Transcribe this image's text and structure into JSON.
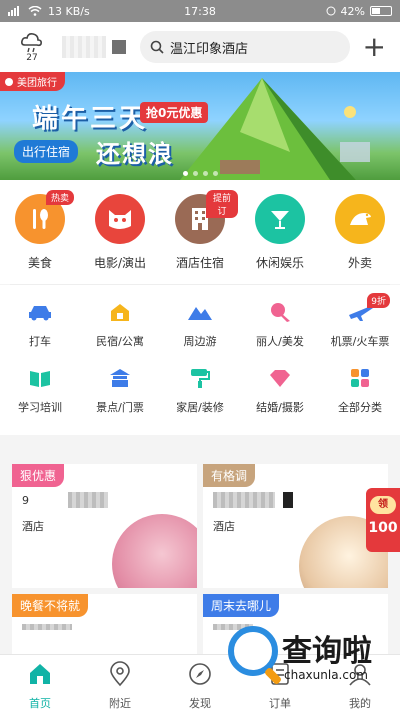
{
  "status_bar": {
    "left_text": "13 KB/s",
    "time": "17:38",
    "battery": "42%"
  },
  "header": {
    "weather_temp": "27",
    "search_text": "温江印象酒店",
    "plus_label": "+"
  },
  "banner": {
    "badge": "美团旅行",
    "title": "端午三天",
    "tag": "抢0元优惠",
    "sub": "出行住宿",
    "big": "还想浪"
  },
  "main_categories": [
    {
      "label": "美食",
      "badge": "热卖",
      "color": "#f7932e"
    },
    {
      "label": "电影/演出",
      "badge": "",
      "color": "#e8453c"
    },
    {
      "label": "酒店住宿",
      "badge": "提前订",
      "color": "#9a6a55"
    },
    {
      "label": "休闲娱乐",
      "badge": "",
      "color": "#1cc3a2"
    },
    {
      "label": "外卖",
      "badge": "",
      "color": "#f6b51c"
    }
  ],
  "sub_categories": [
    {
      "label": "打车",
      "badge": "",
      "icon": "car-icon",
      "color": "#3e7ce8"
    },
    {
      "label": "民宿/公寓",
      "badge": "",
      "icon": "house-icon",
      "color": "#f6b51c"
    },
    {
      "label": "周边游",
      "badge": "",
      "icon": "mountain-icon",
      "color": "#3e7ce8"
    },
    {
      "label": "丽人/美发",
      "badge": "",
      "icon": "beauty-icon",
      "color": "#f06391"
    },
    {
      "label": "机票/火车票",
      "badge": "9折",
      "icon": "plane-icon",
      "color": "#3e7ce8"
    },
    {
      "label": "学习培训",
      "badge": "",
      "icon": "book-icon",
      "color": "#1cc3a2"
    },
    {
      "label": "景点/门票",
      "badge": "",
      "icon": "temple-icon",
      "color": "#3e7ce8"
    },
    {
      "label": "家居/装修",
      "badge": "",
      "icon": "paint-roller-icon",
      "color": "#1cc3a2"
    },
    {
      "label": "结婚/摄影",
      "badge": "",
      "icon": "diamond-icon",
      "color": "#f06391"
    },
    {
      "label": "全部分类",
      "badge": "",
      "icon": "grid-icon",
      "color": "#f7932e"
    }
  ],
  "cards": {
    "c1": {
      "tag": "狠优惠",
      "prefix": "9",
      "line": "酒店"
    },
    "c2": {
      "tag": "有格调",
      "line": "酒店"
    },
    "c3": {
      "tag": "晚餐不将就"
    },
    "c4": {
      "tag": "周末去哪儿"
    }
  },
  "coupon": {
    "pill": "领",
    "amount": "100"
  },
  "bottom_nav": [
    {
      "label": "首页",
      "icon": "home-icon"
    },
    {
      "label": "附近",
      "icon": "location-pin-icon"
    },
    {
      "label": "发现",
      "icon": "compass-icon"
    },
    {
      "label": "订单",
      "icon": "order-icon"
    },
    {
      "label": "我的",
      "icon": "profile-icon"
    }
  ],
  "watermark": {
    "text": "查询啦",
    "url": "chaxunla.com"
  },
  "colors": {
    "accent": "#11b3a6",
    "red": "#e4393c"
  }
}
